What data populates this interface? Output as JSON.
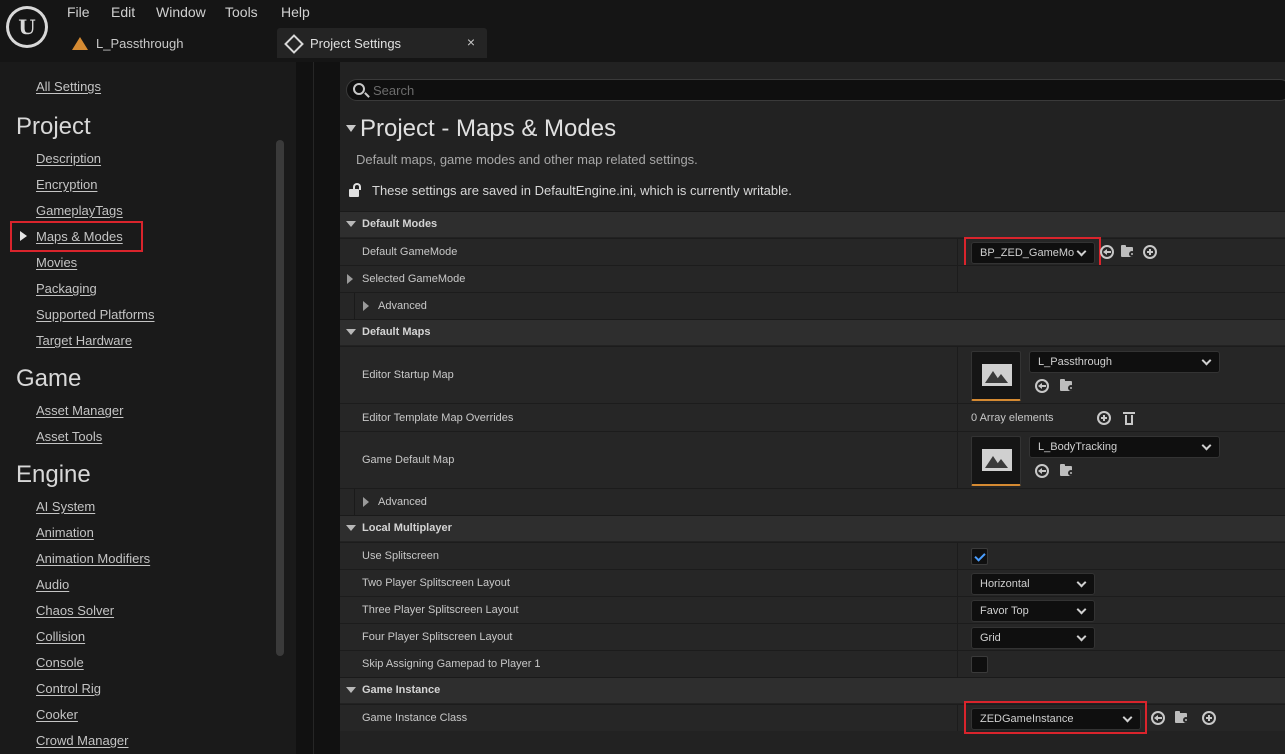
{
  "app": {
    "logo": "unreal-engine-logo"
  },
  "menu": [
    "File",
    "Edit",
    "Window",
    "Tools",
    "Help"
  ],
  "level_tab": {
    "label": "L_Passthrough"
  },
  "settings_tab": {
    "label": "Project Settings",
    "close": "×"
  },
  "sidebar": {
    "all_settings": "All Settings",
    "sections": [
      {
        "heading": "Project",
        "items": [
          "Description",
          "Encryption",
          "GameplayTags",
          "Maps & Modes",
          "Movies",
          "Packaging",
          "Supported Platforms",
          "Target Hardware"
        ]
      },
      {
        "heading": "Game",
        "items": [
          "Asset Manager",
          "Asset Tools"
        ]
      },
      {
        "heading": "Engine",
        "items": [
          "AI System",
          "Animation",
          "Animation Modifiers",
          "Audio",
          "Chaos Solver",
          "Collision",
          "Console",
          "Control Rig",
          "Cooker",
          "Crowd Manager"
        ]
      }
    ],
    "selected": "Maps & Modes"
  },
  "main": {
    "search_placeholder": "Search",
    "title": "Project - Maps & Modes",
    "description": "Default maps, game modes and other map related settings.",
    "writable_notice": "These settings are saved in DefaultEngine.ini, which is currently writable.",
    "categories": {
      "default_modes": "Default Modes",
      "default_maps": "Default Maps",
      "local_multiplayer": "Local Multiplayer",
      "game_instance": "Game Instance"
    },
    "props": {
      "default_gamemode": {
        "label": "Default GameMode",
        "value": "BP_ZED_GameMo"
      },
      "selected_gamemode": {
        "label": "Selected GameMode"
      },
      "advanced_1": {
        "label": "Advanced"
      },
      "editor_startup_map": {
        "label": "Editor Startup Map",
        "value": "L_Passthrough"
      },
      "editor_template_map_overrides": {
        "label": "Editor Template Map Overrides",
        "value": "0 Array elements"
      },
      "game_default_map": {
        "label": "Game Default Map",
        "value": "L_BodyTracking"
      },
      "advanced_2": {
        "label": "Advanced"
      },
      "use_splitscreen": {
        "label": "Use Splitscreen",
        "checked": true
      },
      "two_player_layout": {
        "label": "Two Player Splitscreen Layout",
        "value": "Horizontal"
      },
      "three_player_layout": {
        "label": "Three Player Splitscreen Layout",
        "value": "Favor Top"
      },
      "four_player_layout": {
        "label": "Four Player Splitscreen Layout",
        "value": "Grid"
      },
      "skip_gamepad": {
        "label": "Skip Assigning Gamepad to Player 1",
        "checked": false
      },
      "game_instance_class": {
        "label": "Game Instance Class",
        "value": "ZEDGameInstance"
      }
    }
  },
  "colors": {
    "highlight": "#d9242c",
    "accent_orange": "#d58a32",
    "check_blue": "#4a9eff"
  }
}
